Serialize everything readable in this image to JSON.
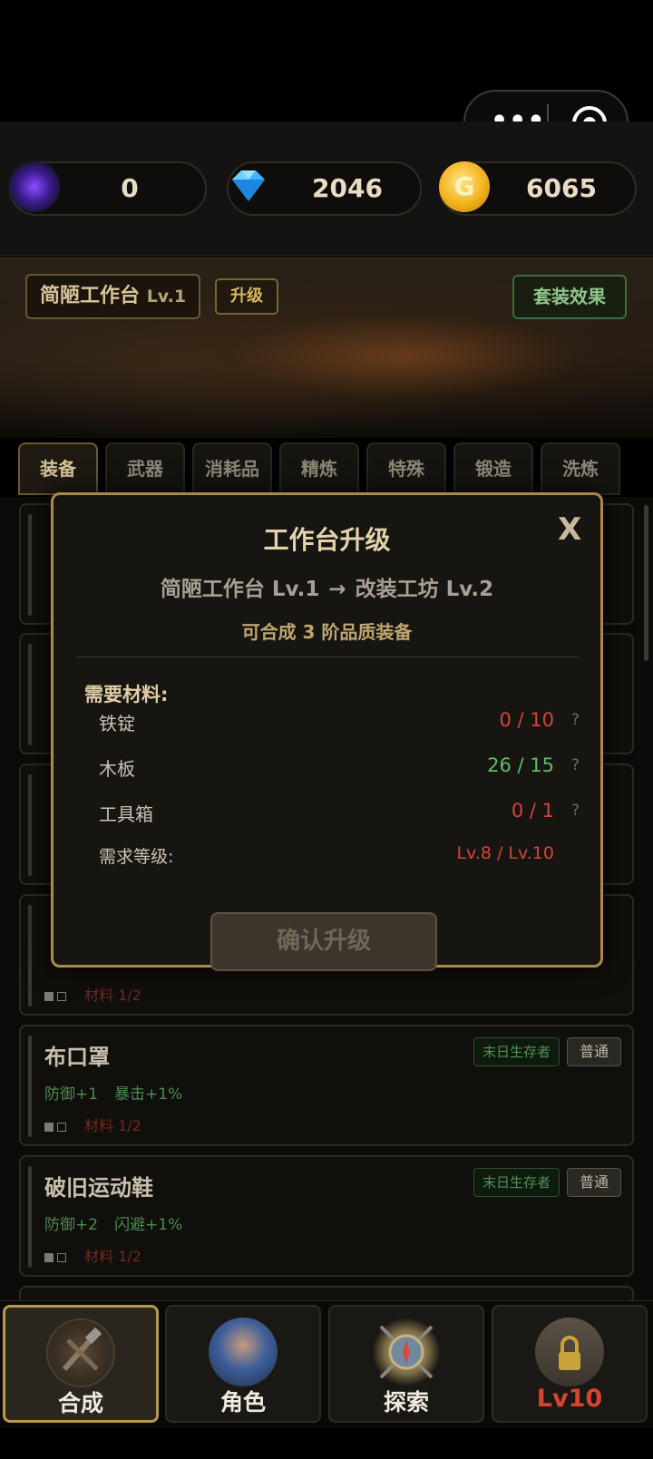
{
  "menu_capsule": {
    "more_icon": "more-dots-icon",
    "close_icon": "target-close-icon"
  },
  "resources": [
    {
      "icon": "purple-gem-icon",
      "value": "0"
    },
    {
      "icon": "diamond-icon",
      "value": "2046"
    },
    {
      "icon": "gold-coin-icon",
      "value": "6065",
      "glyph": "G"
    }
  ],
  "workshop": {
    "name": "简陋工作台",
    "level": "Lv.1",
    "upgrade_label": "升级",
    "set_effect_label": "套装效果"
  },
  "tabs": [
    "装备",
    "武器",
    "消耗品",
    "精炼",
    "特殊",
    "锻造",
    "洗炼"
  ],
  "active_tab": 0,
  "list_items": [
    {
      "title": "",
      "stats": [],
      "mats": ""
    },
    {
      "title": "",
      "stats": [],
      "mats": ""
    },
    {
      "title": "",
      "stats": [],
      "mats": ""
    },
    {
      "title": "",
      "stats": [],
      "mats": "材料 1/2"
    },
    {
      "title": "布口罩",
      "stats": [
        "防御+1",
        "暴击+1%"
      ],
      "mats": "材料 1/2",
      "tag": "末日生存者",
      "rarity": "普通"
    },
    {
      "title": "破旧运动鞋",
      "stats": [
        "防御+2",
        "闪避+1%"
      ],
      "mats": "材料 1/2",
      "tag": "末日生存者",
      "rarity": "普通"
    }
  ],
  "modal": {
    "title": "工作台升级",
    "from": "简陋工作台 Lv.1",
    "arrow": "→",
    "to": "改装工坊 Lv.2",
    "desc": "可合成 3 阶品质装备",
    "close_label": "X",
    "need_label": "需要材料:",
    "materials": [
      {
        "name": "铁锭",
        "qty": "0 / 10",
        "status": "red",
        "help": "?"
      },
      {
        "name": "木板",
        "qty": "26 / 15",
        "status": "green",
        "help": "?"
      },
      {
        "name": "工具箱",
        "qty": "0 / 1",
        "status": "red",
        "help": "?"
      }
    ],
    "level_label": "需求等级:",
    "level_value": "Lv.8 / Lv.10",
    "confirm_label": "确认升级"
  },
  "nav": [
    {
      "label": "合成",
      "icon": "craft-tools-icon",
      "active": true
    },
    {
      "label": "角色",
      "icon": "character-portrait-icon",
      "active": false
    },
    {
      "label": "探索",
      "icon": "compass-swords-icon",
      "active": false
    },
    {
      "label": "Lv10",
      "icon": "locked-shop-icon",
      "active": false
    }
  ],
  "colors": {
    "accent_gold": "#a88b4c",
    "danger": "#d5433a",
    "ok": "#5fbf62"
  }
}
